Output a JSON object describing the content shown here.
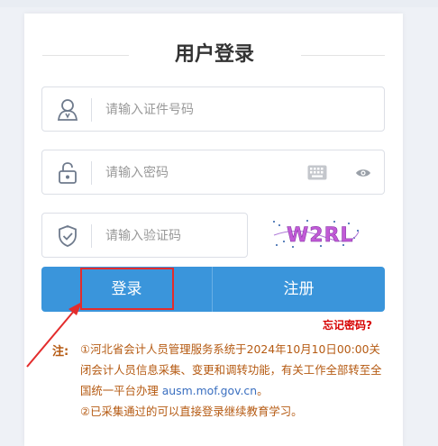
{
  "login": {
    "title": "用户登录",
    "id_placeholder": "请输入证件号码",
    "password_placeholder": "请输入密码",
    "captcha_placeholder": "请输入验证码",
    "captcha_text": "W2RL",
    "login_button": "登录",
    "register_button": "注册",
    "forgot_link": "忘记密码?"
  },
  "notice": {
    "label": "注:",
    "line1_before": "①河北省会计人员管理服务系统于2024年10月10日00:00关闭会计人员信息采集、变更和调转功能，有关工作全部转至全国统一平台办理 ",
    "link": "ausm.mof.gov.cn",
    "line1_after": "。",
    "line2": "②已采集通过的可以直接登录继续教育学习。"
  },
  "colors": {
    "accent": "#3a95db",
    "highlight": "#e32c2c",
    "notice": "#b55a12",
    "forgot": "#d60000"
  }
}
